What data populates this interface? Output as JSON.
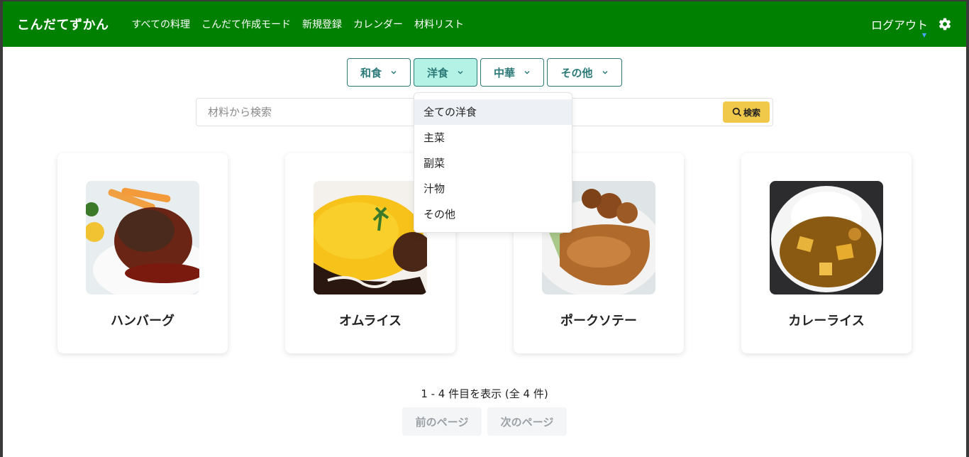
{
  "brand": "こんだてずかん",
  "nav": [
    "すべての料理",
    "こんだて作成モード",
    "新規登録",
    "カレンダー",
    "材料リスト"
  ],
  "logout": "ログアウト",
  "categories": [
    {
      "label": "和食",
      "active": false
    },
    {
      "label": "洋食",
      "active": true
    },
    {
      "label": "中華",
      "active": false
    },
    {
      "label": "その他",
      "active": false
    }
  ],
  "search": {
    "placeholder": "材料から検索",
    "button": "検索"
  },
  "dropdown": [
    "全ての洋食",
    "主菜",
    "副菜",
    "汁物",
    "その他"
  ],
  "cards": [
    {
      "title": "ハンバーグ",
      "image": "hamburg-steak-photo"
    },
    {
      "title": "オムライス",
      "image": "omurice-photo"
    },
    {
      "title": "ポークソテー",
      "image": "pork-saute-photo"
    },
    {
      "title": "カレーライス",
      "image": "curry-rice-photo"
    }
  ],
  "pager": {
    "info": "1 - 4 件目を表示 (全 4 件)",
    "prev": "前のページ",
    "next": "次のページ"
  },
  "colors": {
    "header": "#008000",
    "accent": "#2b7a78",
    "active_bg": "#b5f2e6",
    "search_btn": "#f0c94a"
  }
}
